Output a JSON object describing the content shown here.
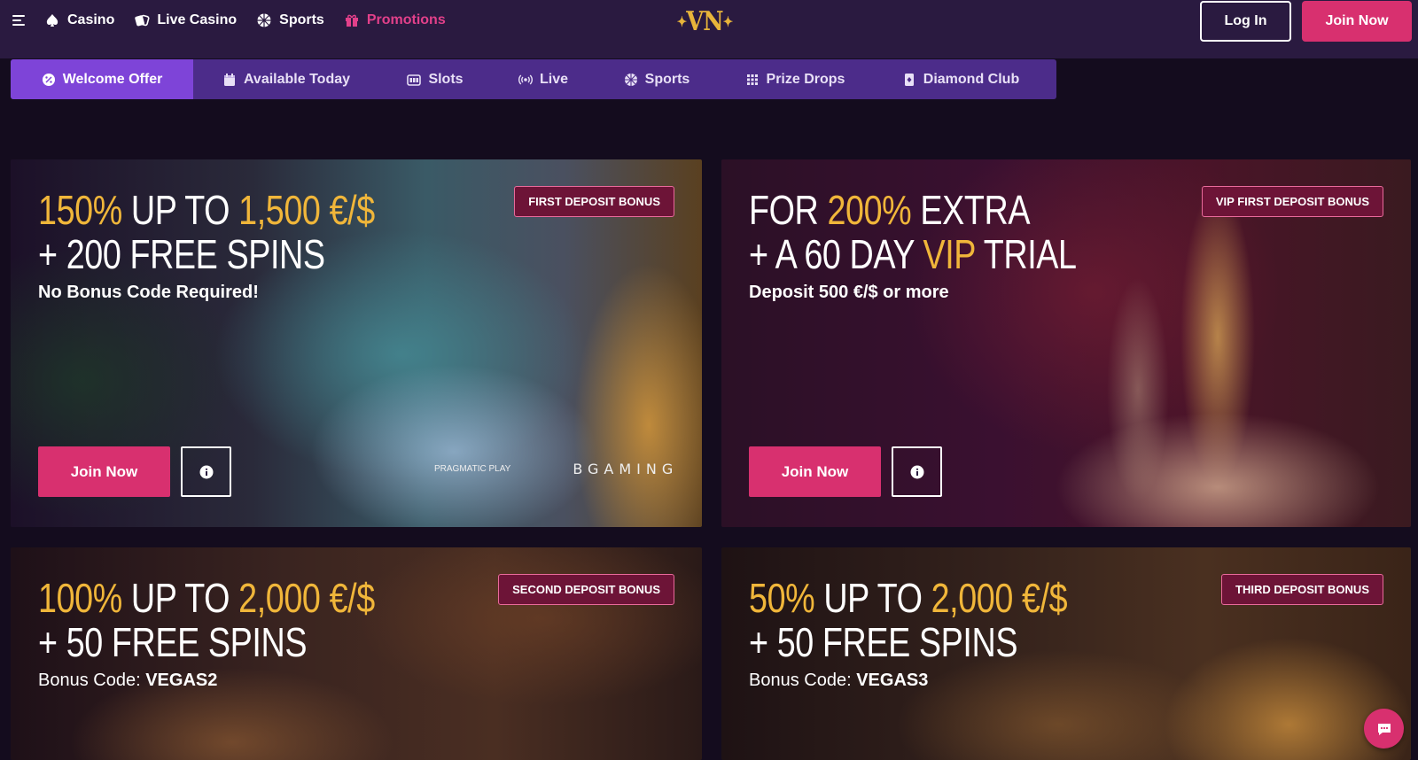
{
  "header": {
    "nav": [
      {
        "label": "Casino",
        "icon": "casino-icon"
      },
      {
        "label": "Live Casino",
        "icon": "live-casino-icon"
      },
      {
        "label": "Sports",
        "icon": "sports-ball-icon"
      },
      {
        "label": "Promotions",
        "icon": "gift-icon"
      }
    ],
    "logo_text": "VN",
    "login_label": "Log In",
    "join_label": "Join Now",
    "accent_color": "#d8306f",
    "promo_color": "#e2408a"
  },
  "tabs": [
    {
      "label": "Welcome Offer",
      "icon": "percent-badge-icon",
      "active": true
    },
    {
      "label": "Available Today",
      "icon": "calendar-icon",
      "active": false
    },
    {
      "label": "Slots",
      "icon": "slot-machine-icon",
      "active": false
    },
    {
      "label": "Live",
      "icon": "broadcast-icon",
      "active": false
    },
    {
      "label": "Sports",
      "icon": "sports-ball-icon",
      "active": false
    },
    {
      "label": "Prize Drops",
      "icon": "grid-dots-icon",
      "active": false
    },
    {
      "label": "Diamond Club",
      "icon": "diamond-card-icon",
      "active": false
    }
  ],
  "cards": [
    {
      "badge": "FIRST DEPOSIT BONUS",
      "line1": [
        {
          "t": "150%",
          "y": true
        },
        {
          "t": " UP TO ",
          "y": false
        },
        {
          "t": "1,500 €/$",
          "y": true
        }
      ],
      "line2": [
        {
          "t": "+ 200 FREE SPINS",
          "y": false
        }
      ],
      "subtitle": "No Bonus Code Required!",
      "subtitle_code": "",
      "join_label": "Join Now",
      "providers": [
        "PRAGMATIC PLAY",
        "BGAMING"
      ]
    },
    {
      "badge": "VIP FIRST DEPOSIT BONUS",
      "line1": [
        {
          "t": "FOR ",
          "y": false
        },
        {
          "t": "200%",
          "y": true
        },
        {
          "t": " EXTRA",
          "y": false
        }
      ],
      "line2": [
        {
          "t": "+ A 60 DAY ",
          "y": false
        },
        {
          "t": "VIP",
          "y": true
        },
        {
          "t": " TRIAL",
          "y": false
        }
      ],
      "subtitle": "Deposit 500 €/$ or more",
      "subtitle_code": "",
      "join_label": "Join Now",
      "providers": []
    },
    {
      "badge": "SECOND DEPOSIT BONUS",
      "line1": [
        {
          "t": "100%",
          "y": true
        },
        {
          "t": " UP TO ",
          "y": false
        },
        {
          "t": "2,000 €/$",
          "y": true
        }
      ],
      "line2": [
        {
          "t": "+ 50 FREE SPINS",
          "y": false
        }
      ],
      "subtitle": "Bonus Code: ",
      "subtitle_code": "VEGAS2",
      "join_label": "",
      "providers": []
    },
    {
      "badge": "THIRD DEPOSIT BONUS",
      "line1": [
        {
          "t": "50%",
          "y": true
        },
        {
          "t": " UP TO ",
          "y": false
        },
        {
          "t": "2,000 €/$",
          "y": true
        }
      ],
      "line2": [
        {
          "t": "+ 50 FREE SPINS",
          "y": false
        }
      ],
      "subtitle": "Bonus Code: ",
      "subtitle_code": "VEGAS3",
      "join_label": "",
      "providers": []
    }
  ],
  "chat_icon": "chat-icon"
}
